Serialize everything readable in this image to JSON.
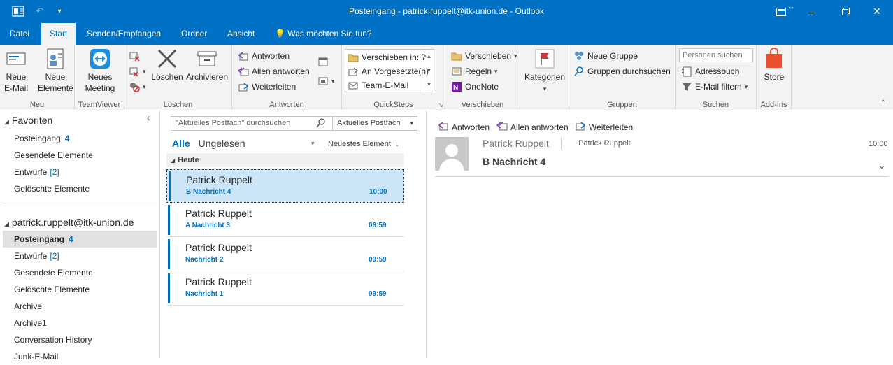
{
  "window": {
    "title": "Posteingang - patrick.ruppelt@itk-union.de  -  Outlook"
  },
  "tabs": [
    "Datei",
    "Start",
    "Senden/Empfangen",
    "Ordner",
    "Ansicht"
  ],
  "tell_me": "Was möchten Sie tun?",
  "ribbon": {
    "neu": {
      "label": "Neu",
      "new_email": "Neue\nE-Mail",
      "new_items": "Neue\nElemente"
    },
    "teamviewer": {
      "label": "TeamViewer",
      "meeting": "Neues\nMeeting"
    },
    "loeschen": {
      "label": "Löschen",
      "delete": "Löschen",
      "archive": "Archivieren"
    },
    "antworten": {
      "label": "Antworten",
      "reply": "Antworten",
      "reply_all": "Allen antworten",
      "forward": "Weiterleiten"
    },
    "quicksteps": {
      "label": "QuickSteps",
      "items": [
        "Verschieben in: ?",
        "An Vorgesetzte(n)",
        "Team-E-Mail"
      ]
    },
    "verschieben": {
      "label": "Verschieben",
      "move": "Verschieben",
      "rules": "Regeln",
      "onenote": "OneNote"
    },
    "kategorien": {
      "label": "Kategorien"
    },
    "gruppen": {
      "label": "Gruppen",
      "new_group": "Neue Gruppe",
      "browse_groups": "Gruppen durchsuchen"
    },
    "suchen": {
      "label": "Suchen",
      "search_people_placeholder": "Personen suchen",
      "address_book": "Adressbuch",
      "filter_email": "E-Mail filtern"
    },
    "addins": {
      "label": "Add-Ins",
      "store": "Store"
    }
  },
  "nav": {
    "favorites_header": "Favoriten",
    "favorites": [
      {
        "label": "Posteingang",
        "count": "4"
      },
      {
        "label": "Gesendete Elemente"
      },
      {
        "label": "Entwürfe",
        "bracket": "[2]"
      },
      {
        "label": "Gelöschte Elemente"
      }
    ],
    "account_header": "patrick.ruppelt@itk-union.de",
    "folders": [
      {
        "label": "Posteingang",
        "count": "4"
      },
      {
        "label": "Entwürfe",
        "bracket": "[2]"
      },
      {
        "label": "Gesendete Elemente"
      },
      {
        "label": "Gelöschte Elemente"
      },
      {
        "label": "Archive"
      },
      {
        "label": "Archive1"
      },
      {
        "label": "Conversation History"
      },
      {
        "label": "Junk-E-Mail"
      }
    ]
  },
  "list": {
    "search_placeholder": "\"Aktuelles Postfach\" durchsuchen",
    "search_scope": "Aktuelles Postfach",
    "filter_all": "Alle",
    "filter_unread": "Ungelesen",
    "sort": "Neuestes Element",
    "group_header": "Heute",
    "messages": [
      {
        "from": "Patrick Ruppelt",
        "subject": "B Nachricht 4",
        "time": "10:00"
      },
      {
        "from": "Patrick Ruppelt",
        "subject": "A Nachricht 3",
        "time": "09:59"
      },
      {
        "from": "Patrick Ruppelt",
        "subject": "Nachricht 2",
        "time": "09:59"
      },
      {
        "from": "Patrick Ruppelt",
        "subject": "Nachricht 1",
        "time": "09:59"
      }
    ]
  },
  "reading": {
    "reply": "Antworten",
    "reply_all": "Allen antworten",
    "forward": "Weiterleiten",
    "from": "Patrick Ruppelt",
    "to": "Patrick Ruppelt",
    "subject": "B Nachricht 4",
    "time": "10:00"
  },
  "colors": {
    "accent": "#0072c6",
    "selected_row": "#cde6f7"
  }
}
